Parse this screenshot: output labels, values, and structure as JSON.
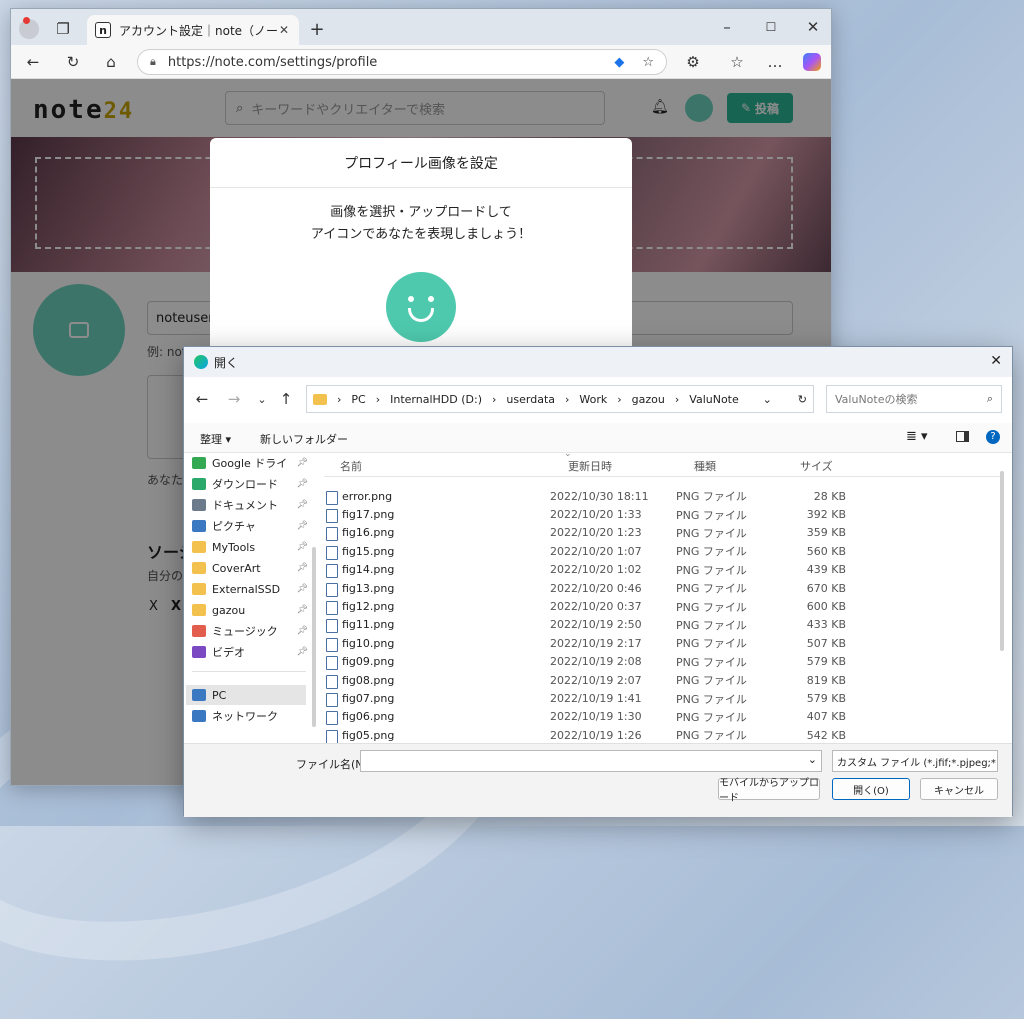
{
  "browser": {
    "tab_title": "アカウント設定｜note（ノート）",
    "tab_favicon": "n",
    "url": "https://note.com/settings/profile"
  },
  "note": {
    "logo_text": "note",
    "logo_num": "24",
    "search_placeholder": "キーワードやクリエイターで検索",
    "post_label": "投稿",
    "username": "noteuser",
    "name_hint": "例: not",
    "bio_hint": "あなた",
    "social_title": "ソーシ",
    "social_sub": "自分の",
    "x_label": "X",
    "x_mark": "X"
  },
  "modal": {
    "title": "プロフィール画像を設定",
    "line1": "画像を選択・アップロードして",
    "line2": "アイコンであなたを表現しましょう！"
  },
  "dialog": {
    "title": "開く",
    "path": [
      "PC",
      "InternalHDD (D:)",
      "userdata",
      "Work",
      "gazou",
      "ValuNote"
    ],
    "search_placeholder": "ValuNoteの検索",
    "organize": "整理",
    "new_folder": "新しいフォルダー",
    "sidebar": [
      {
        "label": "Google ドライ",
        "color": "#34a853",
        "pinned": true
      },
      {
        "label": "ダウンロード",
        "color": "#2aa96b",
        "pinned": true
      },
      {
        "label": "ドキュメント",
        "color": "#6b7b8c",
        "pinned": true
      },
      {
        "label": "ピクチャ",
        "color": "#3a78c2",
        "pinned": true
      },
      {
        "label": "MyTools",
        "color": "#f2c14e",
        "pinned": true
      },
      {
        "label": "CoverArt",
        "color": "#f2c14e",
        "pinned": true
      },
      {
        "label": "ExternalSSD",
        "color": "#f2c14e",
        "pinned": true
      },
      {
        "label": "gazou",
        "color": "#f2c14e",
        "pinned": true
      },
      {
        "label": "ミュージック",
        "color": "#e35d4f",
        "pinned": true
      },
      {
        "label": "ビデオ",
        "color": "#7b4ac2",
        "pinned": true
      },
      {
        "label": "PC",
        "color": "#3a78c2",
        "pinned": false
      },
      {
        "label": "ネットワーク",
        "color": "#3a78c2",
        "pinned": false
      }
    ],
    "columns": {
      "name": "名前",
      "date": "更新日時",
      "type": "種類",
      "size": "サイズ"
    },
    "files": [
      {
        "name": "error.png",
        "date": "2022/10/30 18:11",
        "type": "PNG ファイル",
        "size": "28 KB"
      },
      {
        "name": "fig17.png",
        "date": "2022/10/20 1:33",
        "type": "PNG ファイル",
        "size": "392 KB"
      },
      {
        "name": "fig16.png",
        "date": "2022/10/20 1:23",
        "type": "PNG ファイル",
        "size": "359 KB"
      },
      {
        "name": "fig15.png",
        "date": "2022/10/20 1:07",
        "type": "PNG ファイル",
        "size": "560 KB"
      },
      {
        "name": "fig14.png",
        "date": "2022/10/20 1:02",
        "type": "PNG ファイル",
        "size": "439 KB"
      },
      {
        "name": "fig13.png",
        "date": "2022/10/20 0:46",
        "type": "PNG ファイル",
        "size": "670 KB"
      },
      {
        "name": "fig12.png",
        "date": "2022/10/20 0:37",
        "type": "PNG ファイル",
        "size": "600 KB"
      },
      {
        "name": "fig11.png",
        "date": "2022/10/19 2:50",
        "type": "PNG ファイル",
        "size": "433 KB"
      },
      {
        "name": "fig10.png",
        "date": "2022/10/19 2:17",
        "type": "PNG ファイル",
        "size": "507 KB"
      },
      {
        "name": "fig09.png",
        "date": "2022/10/19 2:08",
        "type": "PNG ファイル",
        "size": "579 KB"
      },
      {
        "name": "fig08.png",
        "date": "2022/10/19 2:07",
        "type": "PNG ファイル",
        "size": "819 KB"
      },
      {
        "name": "fig07.png",
        "date": "2022/10/19 1:41",
        "type": "PNG ファイル",
        "size": "579 KB"
      },
      {
        "name": "fig06.png",
        "date": "2022/10/19 1:30",
        "type": "PNG ファイル",
        "size": "407 KB"
      },
      {
        "name": "fig05.png",
        "date": "2022/10/19 1:26",
        "type": "PNG ファイル",
        "size": "542 KB"
      }
    ],
    "filename_label": "ファイル名(N):",
    "filetype": "カスタム ファイル (*.jfif;*.pjpeg;*.jp",
    "upload_mobile": "モバイルからアップロード",
    "open": "開く(O)",
    "cancel": "キャンセル"
  }
}
